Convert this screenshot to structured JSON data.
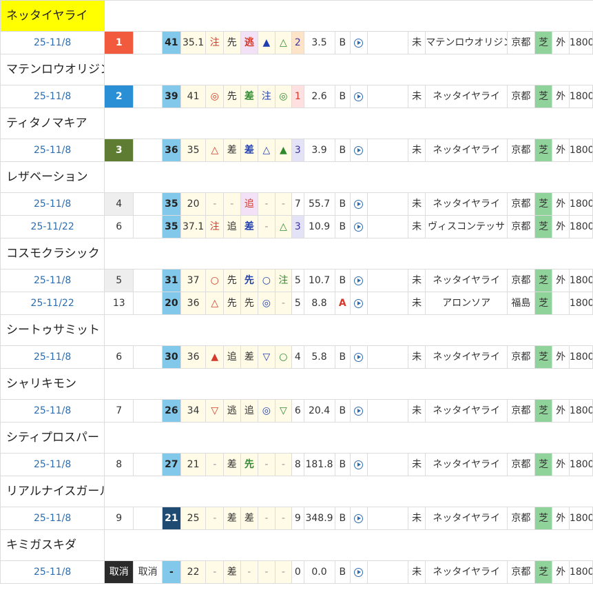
{
  "horses": [
    {
      "name": "ネッタイヤライ",
      "highlight": true,
      "races": [
        {
          "date": "25-11/8",
          "rank": "1",
          "rank_style": "r1",
          "idx": "41",
          "idx_dark": false,
          "val": "35.1",
          "m1": "注",
          "m1_cls": "red-t",
          "m2": "先",
          "m2_cls": "",
          "m3": "逃",
          "m3_cls": "red-t hl-pink bold",
          "m4": "▲",
          "m4_cls": "blue-t",
          "m5": "△",
          "m5_cls": "green-t",
          "num": "2",
          "num_cls": "odds-orange",
          "odds": "3.5",
          "blinker": "B",
          "blinker_cls": "",
          "cls": "未",
          "opponent": "マテンロウオリジン",
          "venue": "京都",
          "surface": "芝",
          "course": "外",
          "dist": "1800"
        }
      ]
    },
    {
      "name": "マテンロウオリジン",
      "highlight": false,
      "races": [
        {
          "date": "25-11/8",
          "rank": "2",
          "rank_style": "r2",
          "idx": "39",
          "idx_dark": false,
          "val": "41",
          "m1": "◎",
          "m1_cls": "red-t",
          "m2": "先",
          "m2_cls": "",
          "m3": "差",
          "m3_cls": "green-t bold",
          "m4": "注",
          "m4_cls": "blue-t",
          "m5": "◎",
          "m5_cls": "green-t",
          "num": "1",
          "num_cls": "odds-pink",
          "odds": "2.6",
          "blinker": "B",
          "blinker_cls": "",
          "cls": "未",
          "opponent": "ネッタイヤライ",
          "venue": "京都",
          "surface": "芝",
          "course": "外",
          "dist": "1800"
        }
      ]
    },
    {
      "name": "ティタノマキア",
      "highlight": false,
      "races": [
        {
          "date": "25-11/8",
          "rank": "3",
          "rank_style": "r3",
          "idx": "36",
          "idx_dark": false,
          "val": "35",
          "m1": "△",
          "m1_cls": "red-t",
          "m2": "差",
          "m2_cls": "",
          "m3": "差",
          "m3_cls": "blue-t bold",
          "m4": "△",
          "m4_cls": "blue-t",
          "m5": "▲",
          "m5_cls": "green-t",
          "num": "3",
          "num_cls": "odds-purple",
          "odds": "3.9",
          "blinker": "B",
          "blinker_cls": "",
          "cls": "未",
          "opponent": "ネッタイヤライ",
          "venue": "京都",
          "surface": "芝",
          "course": "外",
          "dist": "1800"
        }
      ]
    },
    {
      "name": "レザベーション",
      "highlight": false,
      "races": [
        {
          "date": "25-11/8",
          "rank": "4",
          "rank_style": "rgray",
          "idx": "35",
          "idx_dark": false,
          "val": "20",
          "m1": "-",
          "m1_cls": "dash",
          "m2": "-",
          "m2_cls": "dash",
          "m3": "追",
          "m3_cls": "red-t hl-pink",
          "m4": "-",
          "m4_cls": "dash",
          "m5": "-",
          "m5_cls": "dash",
          "num": "7",
          "num_cls": "",
          "odds": "55.7",
          "blinker": "B",
          "blinker_cls": "",
          "cls": "未",
          "opponent": "ネッタイヤライ",
          "venue": "京都",
          "surface": "芝",
          "course": "外",
          "dist": "1800"
        },
        {
          "date": "25-11/22",
          "rank": "6",
          "rank_style": "",
          "idx": "35",
          "idx_dark": false,
          "val": "37.1",
          "m1": "注",
          "m1_cls": "red-t",
          "m2": "追",
          "m2_cls": "",
          "m3": "差",
          "m3_cls": "blue-t bold",
          "m4": "-",
          "m4_cls": "dash",
          "m5": "△",
          "m5_cls": "green-t",
          "num": "3",
          "num_cls": "odds-purple",
          "odds": "10.9",
          "blinker": "B",
          "blinker_cls": "",
          "cls": "未",
          "opponent": "ヴィスコンテッサ",
          "venue": "京都",
          "surface": "芝",
          "course": "外",
          "dist": "1800"
        }
      ]
    },
    {
      "name": "コスモクラシック",
      "highlight": false,
      "races": [
        {
          "date": "25-11/8",
          "rank": "5",
          "rank_style": "rgray",
          "idx": "31",
          "idx_dark": false,
          "val": "37",
          "m1": "○",
          "m1_cls": "red-t",
          "m2": "先",
          "m2_cls": "",
          "m3": "先",
          "m3_cls": "blue-t bold",
          "m4": "○",
          "m4_cls": "blue-t",
          "m5": "注",
          "m5_cls": "green-t",
          "num": "5",
          "num_cls": "",
          "odds": "10.7",
          "blinker": "B",
          "blinker_cls": "",
          "cls": "未",
          "opponent": "ネッタイヤライ",
          "venue": "京都",
          "surface": "芝",
          "course": "外",
          "dist": "1800"
        },
        {
          "date": "25-11/22",
          "rank": "13",
          "rank_style": "",
          "idx": "20",
          "idx_dark": false,
          "val": "36",
          "m1": "△",
          "m1_cls": "red-t",
          "m2": "先",
          "m2_cls": "",
          "m3": "先",
          "m3_cls": "",
          "m4": "◎",
          "m4_cls": "blue-t",
          "m5": "-",
          "m5_cls": "dash",
          "num": "5",
          "num_cls": "",
          "odds": "8.8",
          "blinker": "A",
          "blinker_cls": "blinker-a",
          "cls": "未",
          "opponent": "アロンソア",
          "venue": "福島",
          "surface": "芝",
          "course": "",
          "dist": "1800"
        }
      ]
    },
    {
      "name": "シートゥサミット",
      "highlight": false,
      "races": [
        {
          "date": "25-11/8",
          "rank": "6",
          "rank_style": "",
          "idx": "30",
          "idx_dark": false,
          "val": "36",
          "m1": "▲",
          "m1_cls": "red-t",
          "m2": "追",
          "m2_cls": "",
          "m3": "差",
          "m3_cls": "",
          "m4": "▽",
          "m4_cls": "blue-t",
          "m5": "○",
          "m5_cls": "green-t",
          "num": "4",
          "num_cls": "",
          "odds": "5.8",
          "blinker": "B",
          "blinker_cls": "",
          "cls": "未",
          "opponent": "ネッタイヤライ",
          "venue": "京都",
          "surface": "芝",
          "course": "外",
          "dist": "1800"
        }
      ]
    },
    {
      "name": "シャリキモン",
      "highlight": false,
      "races": [
        {
          "date": "25-11/8",
          "rank": "7",
          "rank_style": "",
          "idx": "26",
          "idx_dark": false,
          "val": "34",
          "m1": "▽",
          "m1_cls": "red-t",
          "m2": "逃",
          "m2_cls": "",
          "m3": "追",
          "m3_cls": "",
          "m4": "◎",
          "m4_cls": "blue-t",
          "m5": "▽",
          "m5_cls": "green-t",
          "num": "6",
          "num_cls": "",
          "odds": "20.4",
          "blinker": "B",
          "blinker_cls": "",
          "cls": "未",
          "opponent": "ネッタイヤライ",
          "venue": "京都",
          "surface": "芝",
          "course": "外",
          "dist": "1800"
        }
      ]
    },
    {
      "name": "シティプロスパー",
      "highlight": false,
      "races": [
        {
          "date": "25-11/8",
          "rank": "8",
          "rank_style": "",
          "idx": "27",
          "idx_dark": false,
          "val": "21",
          "m1": "-",
          "m1_cls": "dash",
          "m2": "差",
          "m2_cls": "",
          "m3": "先",
          "m3_cls": "green-t bold",
          "m4": "-",
          "m4_cls": "dash",
          "m5": "-",
          "m5_cls": "dash",
          "num": "8",
          "num_cls": "",
          "odds": "181.8",
          "blinker": "B",
          "blinker_cls": "",
          "cls": "未",
          "opponent": "ネッタイヤライ",
          "venue": "京都",
          "surface": "芝",
          "course": "外",
          "dist": "1800"
        }
      ]
    },
    {
      "name": "リアルナイスガール",
      "highlight": false,
      "races": [
        {
          "date": "25-11/8",
          "rank": "9",
          "rank_style": "",
          "idx": "21",
          "idx_dark": true,
          "val": "25",
          "m1": "-",
          "m1_cls": "dash",
          "m2": "差",
          "m2_cls": "",
          "m3": "差",
          "m3_cls": "",
          "m4": "-",
          "m4_cls": "dash",
          "m5": "-",
          "m5_cls": "dash",
          "num": "9",
          "num_cls": "",
          "odds": "348.9",
          "blinker": "B",
          "blinker_cls": "",
          "cls": "未",
          "opponent": "ネッタイヤライ",
          "venue": "京都",
          "surface": "芝",
          "course": "外",
          "dist": "1800"
        }
      ]
    },
    {
      "name": "キミガスキダ",
      "highlight": false,
      "races": [
        {
          "date": "25-11/8",
          "rank": "取消",
          "rank_style": "rcancel",
          "note": "取消",
          "idx": "-",
          "idx_dark": false,
          "val": "22",
          "m1": "-",
          "m1_cls": "dash",
          "m2": "差",
          "m2_cls": "",
          "m3": "-",
          "m3_cls": "dash",
          "m4": "-",
          "m4_cls": "dash",
          "m5": "-",
          "m5_cls": "dash",
          "num": "0",
          "num_cls": "",
          "odds": "0.0",
          "blinker": "B",
          "blinker_cls": "",
          "cls": "未",
          "opponent": "ネッタイヤライ",
          "venue": "京都",
          "surface": "芝",
          "course": "外",
          "dist": "1800"
        }
      ]
    }
  ]
}
